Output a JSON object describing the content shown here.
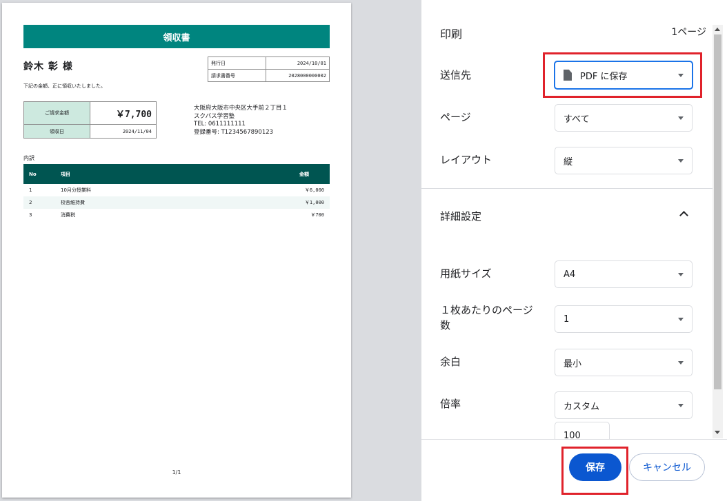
{
  "receipt": {
    "title": "領収書",
    "customer": "鈴木 彰 様",
    "note": "下記の金額、正に領収いたしました。",
    "meta": [
      {
        "label": "発行日",
        "value": "2024/10/01"
      },
      {
        "label": "請求書番号",
        "value": "2028000000002"
      }
    ],
    "amount_label": "ご請求金額",
    "amount_value": "￥7,700",
    "received_label": "領収日",
    "received_value": "2024/11/04",
    "issuer": {
      "address_line1": "大阪府大阪市中央区大手前２丁目１",
      "name": "スクバス学習塾",
      "tel": "TEL: 0611111111",
      "registration": "登録番号: T1234567890123"
    },
    "breakdown_label": "内訳",
    "table_headers": {
      "no": "No",
      "item": "項目",
      "amount": "金額"
    },
    "items": [
      {
        "no": "1",
        "item": "10月分授業料",
        "amount": "￥6,000"
      },
      {
        "no": "2",
        "item": "校舎維持費",
        "amount": "￥1,000"
      },
      {
        "no": "3",
        "item": "消費税",
        "amount": "￥700"
      }
    ],
    "page_number": "1/1"
  },
  "print_panel": {
    "title": "印刷",
    "page_count": "1ページ",
    "destination_label": "送信先",
    "destination_value": "PDF に保存",
    "pages_label": "ページ",
    "pages_value": "すべて",
    "layout_label": "レイアウト",
    "layout_value": "縦",
    "more_settings_label": "詳細設定",
    "paper_size_label": "用紙サイズ",
    "paper_size_value": "A4",
    "pages_per_sheet_label_line1": "１枚あたりのページ",
    "pages_per_sheet_label_line2": "数",
    "pages_per_sheet_value": "1",
    "margins_label": "余白",
    "margins_value": "最小",
    "scale_label": "倍率",
    "scale_value": "カスタム",
    "scale_custom_value": "100",
    "save_button": "保存",
    "cancel_button": "キャンセル"
  },
  "colors": {
    "receipt_title_bg": "#00857f",
    "table_header_bg": "#005551",
    "amount_label_bg": "#cde9df",
    "primary_button": "#0b57d0",
    "highlight_box": "#e0222b"
  }
}
